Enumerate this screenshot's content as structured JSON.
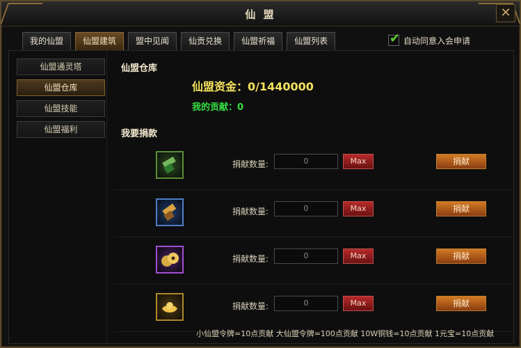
{
  "window": {
    "title": "仙 盟",
    "close_icon": "✕"
  },
  "tabs": [
    {
      "label": "我的仙盟"
    },
    {
      "label": "仙盟建筑"
    },
    {
      "label": "盟中见闻"
    },
    {
      "label": "仙贡兑换"
    },
    {
      "label": "仙盟祈福"
    },
    {
      "label": "仙盟列表"
    }
  ],
  "auto_agree": {
    "label": "自动同意入会申请",
    "checked": true
  },
  "side_nav": [
    {
      "label": "仙盟通灵塔"
    },
    {
      "label": "仙盟仓库"
    },
    {
      "label": "仙盟技能"
    },
    {
      "label": "仙盟福利"
    }
  ],
  "warehouse": {
    "title": "仙盟仓库",
    "fund_text": "仙盟资金：0/1440000",
    "contribution_text": "我的贡献：0"
  },
  "donate_section": {
    "title": "我要捐款",
    "rows": [
      {
        "icon": "small-token-icon",
        "qty_label": "捐献数量:",
        "qty_value": "0",
        "max_label": "Max",
        "donate_label": "捐献"
      },
      {
        "icon": "large-token-icon",
        "qty_label": "捐献数量:",
        "qty_value": "0",
        "max_label": "Max",
        "donate_label": "捐献"
      },
      {
        "icon": "copper-coins-icon",
        "qty_label": "捐献数量:",
        "qty_value": "0",
        "max_label": "Max",
        "donate_label": "捐献"
      },
      {
        "icon": "gold-ingot-icon",
        "qty_label": "捐献数量:",
        "qty_value": "0",
        "max_label": "Max",
        "donate_label": "捐献"
      }
    ],
    "footer_note": "小仙盟令牌=10点贡献 大仙盟令牌=100点贡献 10W铜钱=10点贡献 1元宝=10点贡献"
  }
}
